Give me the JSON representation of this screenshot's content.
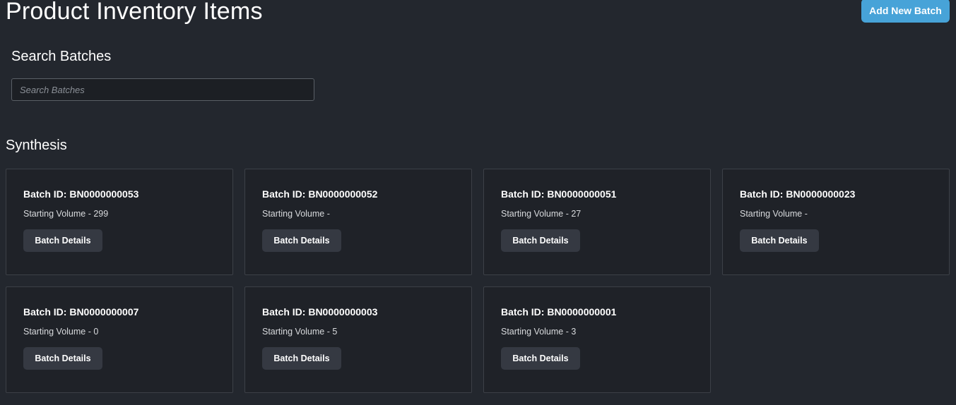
{
  "header": {
    "title": "Product Inventory Items",
    "add_button_label": "Add New Batch"
  },
  "search": {
    "heading": "Search Batches",
    "placeholder": "Search Batches",
    "value": ""
  },
  "section": {
    "title": "Synthesis"
  },
  "batches": [
    {
      "id_label": "Batch ID: BN0000000053",
      "volume_label": "Starting Volume - 299",
      "button_label": "Batch Details"
    },
    {
      "id_label": "Batch ID: BN0000000052",
      "volume_label": "Starting Volume -",
      "button_label": "Batch Details"
    },
    {
      "id_label": "Batch ID: BN0000000051",
      "volume_label": "Starting Volume - 27",
      "button_label": "Batch Details"
    },
    {
      "id_label": "Batch ID: BN0000000023",
      "volume_label": "Starting Volume -",
      "button_label": "Batch Details"
    },
    {
      "id_label": "Batch ID: BN0000000007",
      "volume_label": "Starting Volume - 0",
      "button_label": "Batch Details"
    },
    {
      "id_label": "Batch ID: BN0000000003",
      "volume_label": "Starting Volume - 5",
      "button_label": "Batch Details"
    },
    {
      "id_label": "Batch ID: BN0000000001",
      "volume_label": "Starting Volume - 3",
      "button_label": "Batch Details"
    }
  ],
  "colors": {
    "background": "#23272e",
    "card_background": "#1f2228",
    "accent": "#47a3d8",
    "secondary_button": "#353942"
  }
}
